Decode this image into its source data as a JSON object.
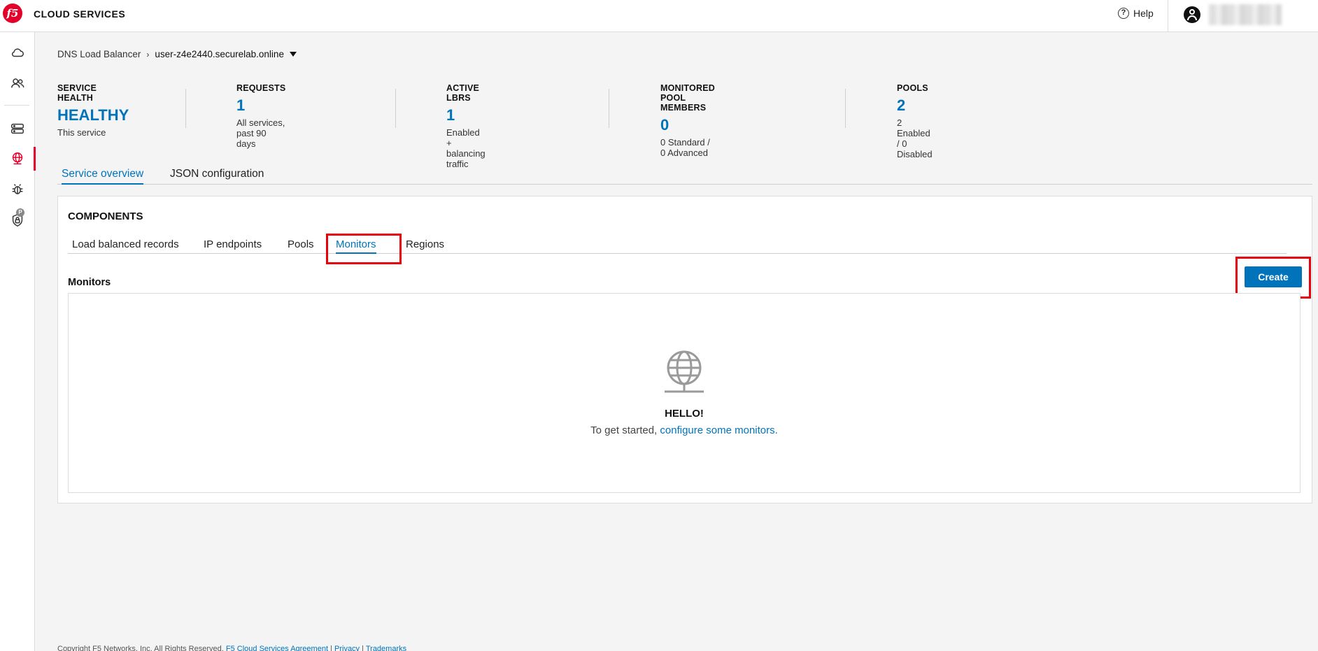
{
  "app": {
    "brand": "CLOUD SERVICES",
    "logo_text": "f5",
    "help_label": "Help"
  },
  "breadcrumb": {
    "root": "DNS Load Balancer",
    "current": "user-z4e2440.securelab.online"
  },
  "stats": [
    {
      "label": "SERVICE HEALTH",
      "value": "HEALTHY",
      "sub": "This service"
    },
    {
      "label": "REQUESTS",
      "value": "1",
      "sub": "All services, past 90 days"
    },
    {
      "label": "ACTIVE LBRS",
      "value": "1",
      "sub": "Enabled + balancing traffic"
    },
    {
      "label": "MONITORED POOL MEMBERS",
      "value": "0",
      "sub": "0 Standard / 0 Advanced"
    },
    {
      "label": "POOLS",
      "value": "2",
      "sub": "2 Enabled / 0 Disabled"
    }
  ],
  "main_tabs": [
    "Service overview",
    "JSON configuration"
  ],
  "components": {
    "title": "COMPONENTS",
    "tabs": [
      "Load balanced records",
      "IP endpoints",
      "Pools",
      "Monitors",
      "Regions"
    ],
    "active_tab": "Monitors",
    "section_title": "Monitors",
    "create_label": "Create",
    "empty_title": "HELLO!",
    "empty_text": "To get started,",
    "empty_link": "configure some monitors."
  },
  "footer": {
    "copyright": "Copyright F5 Networks, Inc. All Rights Reserved.",
    "links": [
      "F5 Cloud Services Agreement",
      "Privacy",
      "Trademarks"
    ]
  },
  "colors": {
    "accent": "#0073bb",
    "brand_red": "#e4002b",
    "highlight": "#e8000b"
  }
}
